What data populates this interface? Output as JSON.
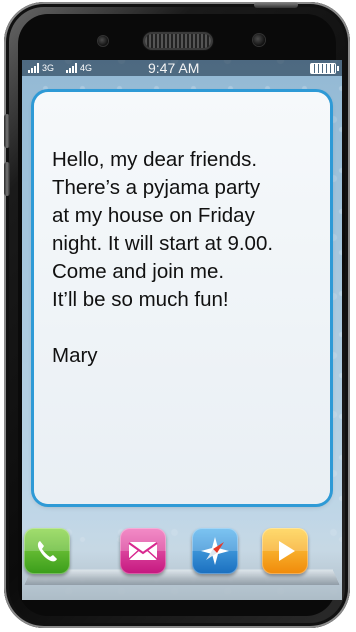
{
  "status_bar": {
    "network_1": "3G",
    "network_2": "4G",
    "time": "9:47 AM"
  },
  "message": {
    "lines": [
      "Hello, my dear friends.",
      "There’s a pyjama party",
      "at my house on Friday",
      "night. It will start at 9.00.",
      "Come and join me.",
      "It’ll be so much fun!"
    ],
    "signature": "Mary"
  },
  "dock": {
    "apps": [
      {
        "icon": "phone-icon",
        "color": "#4caf2a"
      },
      {
        "icon": "mail-icon",
        "color": "#d8288f"
      },
      {
        "icon": "compass-icon",
        "color": "#2a86d3"
      },
      {
        "icon": "play-icon",
        "color": "#f5a516"
      }
    ]
  },
  "colors": {
    "card_border": "#2e9ad6",
    "screen_bg": "#a5c6dd",
    "phone_body": "#0b0b0b"
  }
}
